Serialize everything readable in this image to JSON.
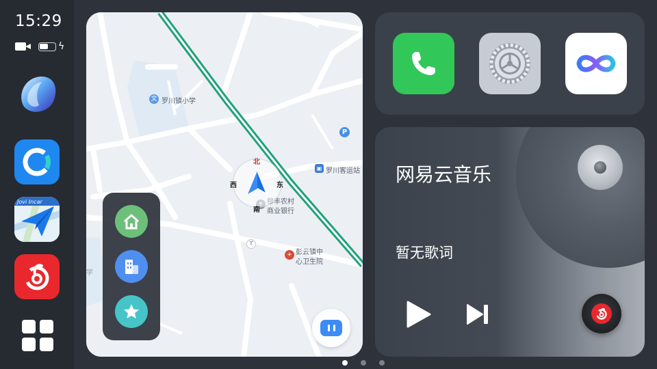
{
  "status": {
    "time": "15:29",
    "battery_level": 0.55
  },
  "dock": {
    "apps": [
      {
        "name": "jovi-assistant",
        "icon": "jovi-orb-icon"
      },
      {
        "name": "connect",
        "icon": "c-ring-icon"
      },
      {
        "name": "jovi-incar-navigation",
        "icon": "paper-plane-map-icon",
        "label": "Jovi Incar"
      },
      {
        "name": "netease-music",
        "icon": "netease-music-icon"
      }
    ],
    "launcher_icon": "grid-icon"
  },
  "map": {
    "labels": {
      "school": "罗川镇小学",
      "bus_station": "罗川客运站",
      "bank_line1": "穆丰农村",
      "bank_line2": "商业银行",
      "hospital_line1": "彭云镇中",
      "hospital_line2": "心卫生院",
      "edge_label": "学"
    },
    "compass": {
      "north": "北",
      "south": "南",
      "west": "西",
      "east": "东"
    },
    "quick_buttons": [
      {
        "name": "home",
        "icon": "home-icon"
      },
      {
        "name": "company",
        "icon": "building-icon"
      },
      {
        "name": "favorites",
        "icon": "star-icon"
      }
    ],
    "floating_button_icon": "voice-assistant-icon"
  },
  "shortcuts": [
    {
      "name": "phone",
      "icon": "phone-icon"
    },
    {
      "name": "settings",
      "icon": "gear-icon"
    },
    {
      "name": "jovi",
      "icon": "infinity-icon"
    }
  ],
  "music": {
    "app_title": "网易云音乐",
    "lyric": "暂无歌词"
  },
  "pagination": {
    "pages": 3,
    "current": 1
  },
  "colors": {
    "route": "#1fa17a",
    "accent_blue": "#3d8cf5",
    "netease_red": "#e8282d",
    "phone_green": "#32c759"
  }
}
